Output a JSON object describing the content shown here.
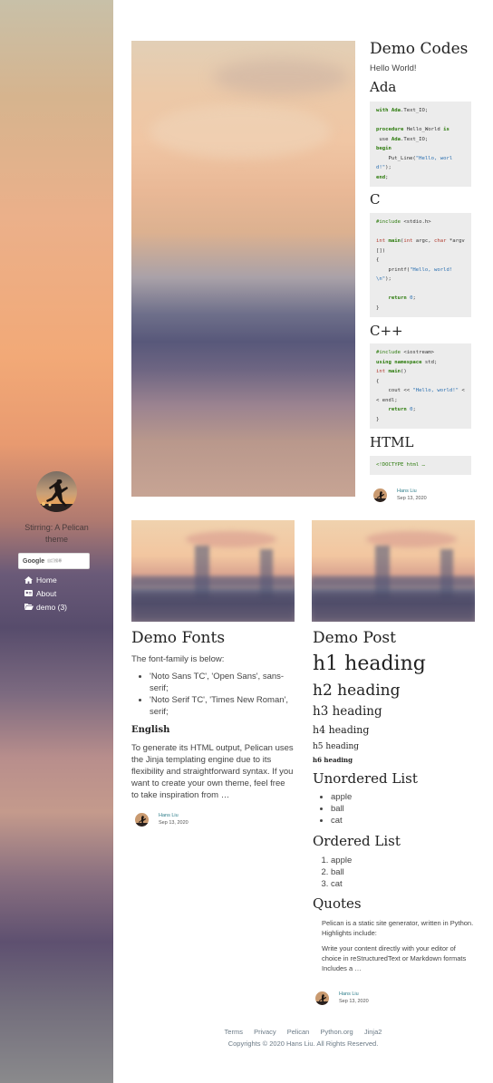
{
  "sidebar": {
    "title": "Stirring: A Pelican theme",
    "search": {
      "brand": "Google",
      "sub": "自訂搜尋"
    },
    "nav": [
      {
        "label": "Home",
        "icon": "home-icon"
      },
      {
        "label": "About",
        "icon": "id-card-icon"
      },
      {
        "label": "demo (3)",
        "icon": "folder-open-icon"
      }
    ]
  },
  "featured": {
    "title": "Demo Codes",
    "intro": "Hello World!",
    "sections": [
      {
        "heading": "Ada"
      },
      {
        "heading": "C"
      },
      {
        "heading": "C++"
      },
      {
        "heading": "HTML"
      }
    ],
    "html_snippet": "<!DOCTYPE html …",
    "author": "Hans Liu",
    "date": "Sep 13, 2020"
  },
  "fonts_card": {
    "title": "Demo Fonts",
    "intro": "The font-family is below:",
    "items": [
      "'Noto Sans TC', 'Open Sans', sans-serif;",
      "'Noto Serif TC', 'Times New Roman', serif;"
    ],
    "subheading": "English",
    "body": "To generate its HTML output, Pelican uses the Jinja templating engine due to its flexibility and straightforward syntax. If you want to create your own theme, feel free to take inspiration from …",
    "author": "Hans Liu",
    "date": "Sep 13, 2020"
  },
  "post_card": {
    "title": "Demo Post",
    "h1": "h1 heading",
    "h2": "h2 heading",
    "h3": "h3 heading",
    "h4": "h4 heading",
    "h5": "h5 heading",
    "h6": "h6 heading",
    "ul_title": "Unordered List",
    "ul_items": [
      "apple",
      "ball",
      "cat"
    ],
    "ol_title": "Ordered List",
    "ol_items": [
      "apple",
      "ball",
      "cat"
    ],
    "quotes_title": "Quotes",
    "quote1": "Pelican is a static site generator, written in Python. Highlights include:",
    "quote2": "Write your content directly with your editor of choice in reStructuredText or Markdown formats Includes a …",
    "author": "Hans Liu",
    "date": "Sep 13, 2020"
  },
  "footer": {
    "links": [
      "Terms",
      "Privacy",
      "Pelican",
      "Python.org",
      "Jinja2"
    ],
    "copyright": "Copyrights © 2020 Hans Liu. All Rights Reserved."
  }
}
